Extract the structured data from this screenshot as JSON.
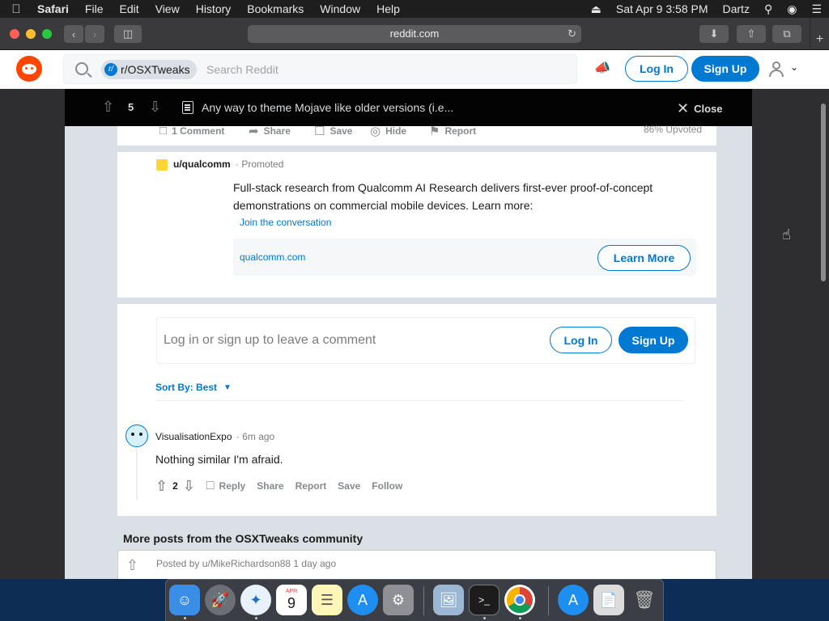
{
  "menubar": {
    "apple": "",
    "app": "Safari",
    "items": [
      "File",
      "Edit",
      "View",
      "History",
      "Bookmarks",
      "Window",
      "Help"
    ],
    "datetime": "Sat Apr 9  3:58 PM",
    "user": "Dartz"
  },
  "browser": {
    "url": "reddit.com"
  },
  "header": {
    "subreddit_chip": "r/OSXTweaks",
    "search_placeholder": "Search Reddit",
    "login": "Log In",
    "signup": "Sign Up"
  },
  "postbar": {
    "vote_count": "5",
    "title": "Any way to theme Mojave like older versions (i.e...",
    "close": "Close"
  },
  "post_actions": {
    "comments": "1 Comment",
    "share": "Share",
    "save": "Save",
    "hide": "Hide",
    "report": "Report",
    "upvoted": "86% Upvoted"
  },
  "promoted": {
    "user": "u/qualcomm",
    "label": "Promoted",
    "text": "Full-stack research from Qualcomm AI Research delivers first-ever proof-of-concept demonstrations on commercial mobile devices. Learn more:",
    "join": "Join the conversation",
    "domain": "qualcomm.com",
    "cta": "Learn More"
  },
  "comment_box": {
    "prompt": "Log in or sign up to leave a comment",
    "login": "Log In",
    "signup": "Sign Up"
  },
  "sort": {
    "label": "Sort By: Best"
  },
  "comments": [
    {
      "author": "VisualisationExpo",
      "time": "6m ago",
      "body": "Nothing similar I'm afraid.",
      "votes": "2",
      "actions": {
        "reply": "Reply",
        "share": "Share",
        "report": "Report",
        "save": "Save",
        "follow": "Follow"
      }
    }
  ],
  "more": {
    "heading": "More posts from the OSXTweaks community",
    "posted_by": "Posted by u/MikeRichardson88 1 day ago"
  },
  "dock": {
    "calendar_month": "APR",
    "calendar_day": "9"
  },
  "colors": {
    "reddit_orange": "#ff4500",
    "reddit_blue": "#0079d3"
  }
}
